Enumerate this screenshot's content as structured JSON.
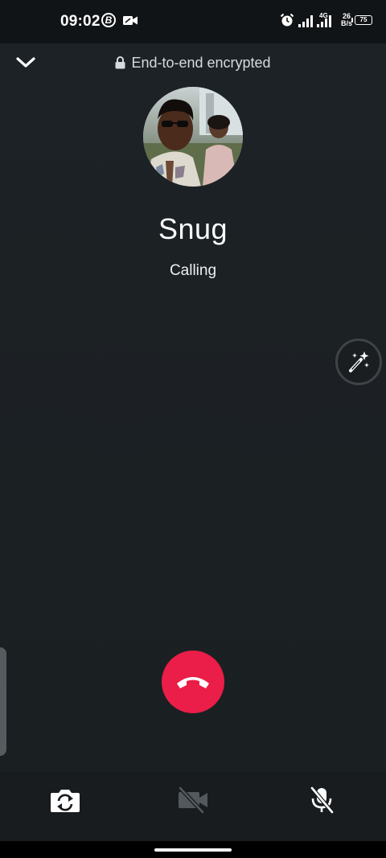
{
  "status_bar": {
    "time": "09:02",
    "b_badge": "B",
    "network_type": "4G",
    "speed_value": "26",
    "speed_unit": "B/s",
    "battery": "75"
  },
  "header": {
    "encryption_label": "End-to-end encrypted"
  },
  "contact": {
    "name": "Snug",
    "status": "Calling"
  },
  "icons": {
    "minimize": "chevron-down-icon",
    "lock": "lock-icon",
    "effects": "magic-wand-icon",
    "end_call": "phone-hangup-icon",
    "flip_camera": "camera-flip-icon",
    "video_off": "video-off-icon",
    "mic_off": "mic-off-icon"
  },
  "colors": {
    "end_call": "#ea1e48",
    "background": "#1c2024"
  }
}
